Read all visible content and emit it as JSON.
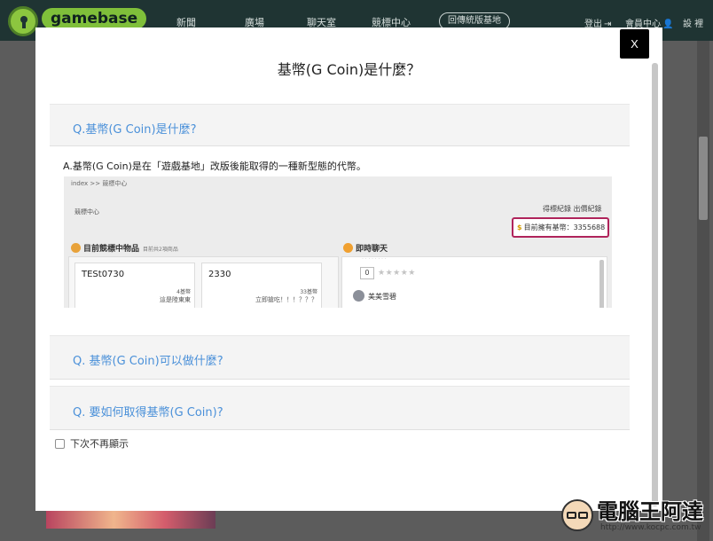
{
  "site": {
    "logo_text": "gamebase",
    "nav": [
      "新聞",
      "廣場",
      "聊天室",
      "競標中心"
    ],
    "nav_pill": "回傳統版基地",
    "logout": "登出",
    "member_center": "會員中心",
    "settings_label": "設 裡"
  },
  "modal": {
    "title": "基幣(G Coin)是什麼？",
    "close_label": "X",
    "faq": [
      {
        "question": "Q.基幣(G Coin)是什麼?",
        "answer": "A.基幣(G Coin)是在「遊戲基地」改版後能取得的一種新型態的代幣。"
      },
      {
        "question": "Q. 基幣(G Coin)可以做什麼?"
      },
      {
        "question": "Q. 要如何取得基幣(G Coin)?"
      }
    ],
    "dont_show_label": "下次不再顯示"
  },
  "screenshot": {
    "breadcrumb": "index  >>  競標中心",
    "subtitle": "競標中心",
    "links": "得標紀錄   出價紀錄",
    "coin_label": "目前擁有基幣：",
    "coin_value": "3355688",
    "items_heading": "目前競標中物品",
    "items_count": "目前共2項商品",
    "chat_heading": "即時聊天",
    "cards": [
      {
        "title": "TESt0730",
        "coins": "4基幣",
        "desc": "這是陸東東"
      },
      {
        "title": "2330",
        "coins": "33基幣",
        "desc": "立即搶吃！！！？？？"
      }
    ],
    "rating": "0",
    "stars": "★★★★★",
    "chat_user": "美美雪碧"
  },
  "watermark": {
    "text": "電腦王阿達",
    "url": "http://www.kocpc.com.tw"
  },
  "colors": {
    "topbar": "#1f3433",
    "logo_green": "#7fbf3a",
    "question_blue": "#4a90d9",
    "highlight_border": "#b0245b",
    "close_button": "#000000"
  },
  "icons": [
    "keyhole-logo-icon",
    "logout-icon",
    "user-icon",
    "coin-icon",
    "chat-icon",
    "avatar-icon",
    "checkbox-icon"
  ]
}
